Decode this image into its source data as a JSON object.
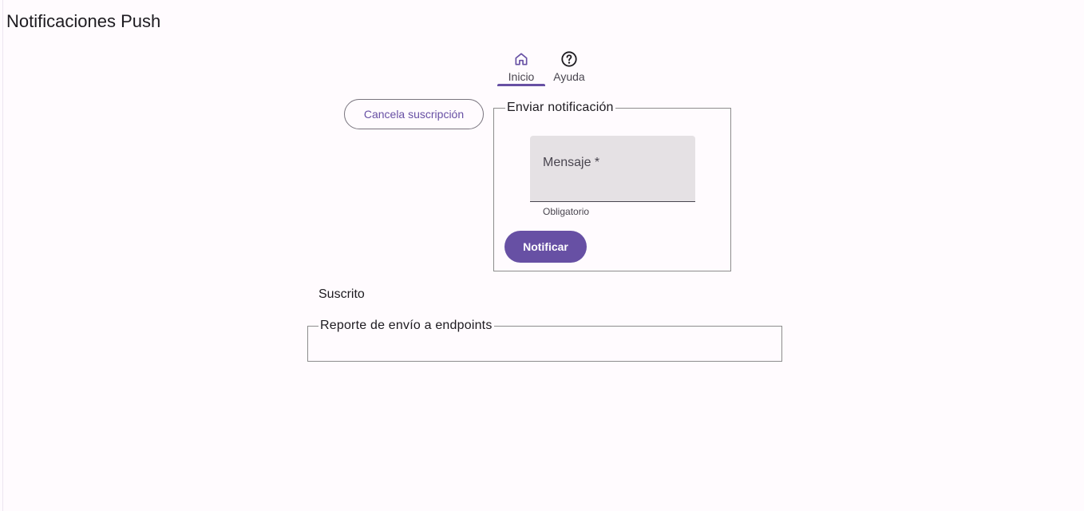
{
  "app": {
    "title": "Notificaciones Push"
  },
  "tabs": [
    {
      "label": "Inicio",
      "icon": "home-icon",
      "active": true
    },
    {
      "label": "Ayuda",
      "icon": "help-circle-icon",
      "active": false
    }
  ],
  "subscription": {
    "cancel_label": "Cancela suscripción",
    "status": "Suscrito"
  },
  "send_panel": {
    "legend": "Enviar notificación",
    "message_field": {
      "label": "Mensaje *",
      "value": "",
      "supporting_text": "Obligatorio"
    },
    "notify_label": "Notificar"
  },
  "report_panel": {
    "legend": "Reporte de envío a endpoints"
  },
  "colors": {
    "primary": "#6750a4",
    "background": "#fffbfe",
    "field_fill": "#e5e1e4",
    "outline": "#79747e"
  }
}
